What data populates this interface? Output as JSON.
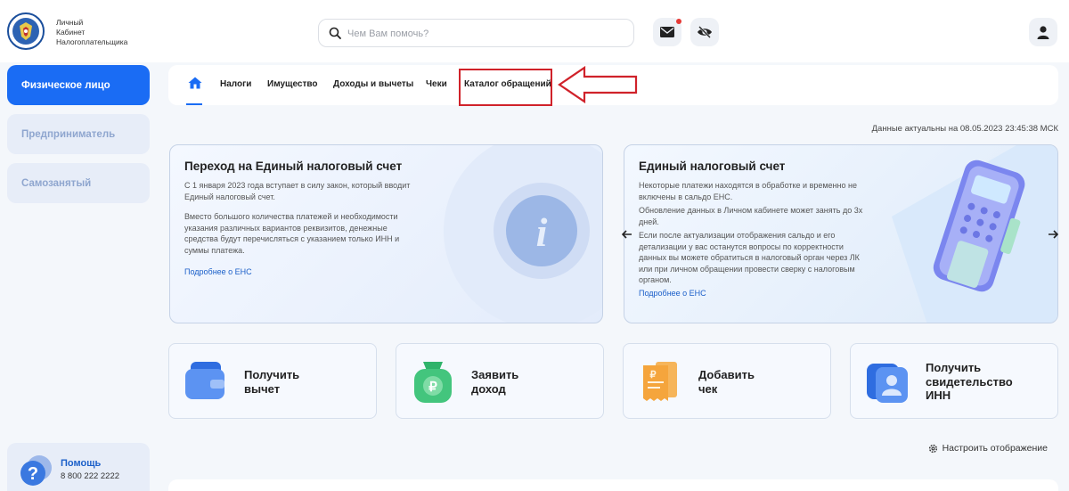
{
  "header": {
    "logo_lines": [
      "Личный",
      "Кабинет",
      "Налогоплательщика"
    ],
    "search_placeholder": "Чем Вам помочь?"
  },
  "sidebar": {
    "items": [
      {
        "label": "Физическое лицо",
        "active": true
      },
      {
        "label": "Предприниматель",
        "active": false
      },
      {
        "label": "Самозанятый",
        "active": false
      }
    ],
    "help": {
      "title": "Помощь",
      "phone": "8 800 222 2222"
    }
  },
  "tabs": [
    "Налоги",
    "Имущество",
    "Доходы и вычеты",
    "Чеки",
    "Каталог обращений"
  ],
  "actual_date": "Данные актуальны на 08.05.2023 23:45:38 МСК",
  "cards": [
    {
      "title": "Переход на Единый налоговый счет",
      "p1": "С 1 января 2023 года вступает в силу закон, который вводит Единый налоговый счет.",
      "p2": "Вместо большого количества платежей и необходимости указания различных вариантов реквизитов, денежные средства будут перечисляться с указанием только ИНН и суммы платежа.",
      "link": "Подробнее о ЕНС"
    },
    {
      "title": "Единый налоговый счет",
      "p1": "Некоторые платежи находятся в обработке и временно не включены в сальдо ЕНС.",
      "p2": "Обновление данных в Личном кабинете может занять до 3х дней.",
      "p3": "Если после актуализации отображения сальдо и его детализации у вас останутся вопросы по корректности данных вы можете обратиться в налоговый орган через ЛК или при личном обращении провести сверку с налоговым органом.",
      "link": "Подробнее о ЕНС"
    }
  ],
  "tiles": [
    {
      "lines": [
        "Получить",
        "вычет"
      ]
    },
    {
      "lines": [
        "Заявить",
        "доход"
      ]
    },
    {
      "lines": [
        "Добавить",
        "чек"
      ]
    },
    {
      "lines": [
        "Получить",
        "свидетельство",
        "ИНН"
      ]
    }
  ],
  "settings_label": "Настроить отображение",
  "colors": {
    "accent": "#1a6cf4",
    "highlight": "#d0222a"
  }
}
